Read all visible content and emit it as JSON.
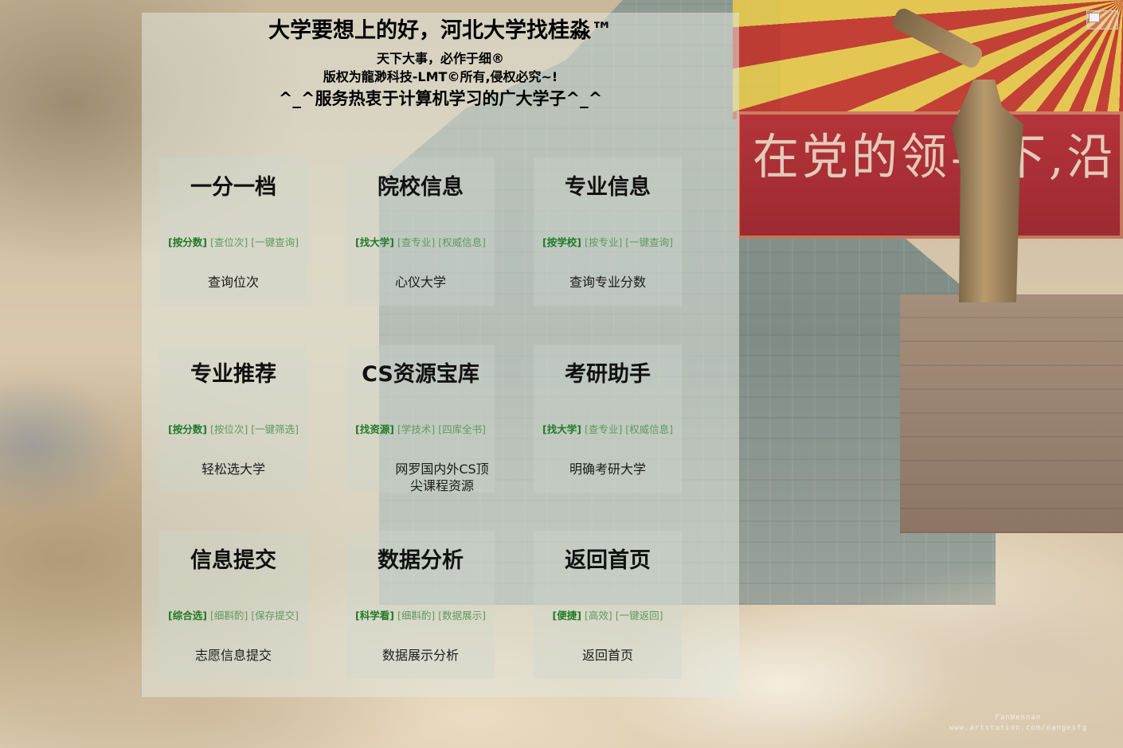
{
  "header": {
    "title": "大学要想上的好，河北大学找桂淼™",
    "line1": "天下大事，必作于细®",
    "line2": "版权为龍渺科技-LMT©所有,侵权必究~!",
    "line3": "^_^服务热衷于计算机学习的广大学子^_^"
  },
  "cards": [
    {
      "title": "一分一档",
      "tags": [
        "[按分数]",
        "[查位次]",
        "[一键查询]"
      ],
      "link": "查询位次"
    },
    {
      "title": "院校信息",
      "tags": [
        "[找大学]",
        "[查专业]",
        "[权威信息]"
      ],
      "link": "心仪大学"
    },
    {
      "title": "专业信息",
      "tags": [
        "[按学校]",
        "[按专业]",
        "[一键查询]"
      ],
      "link": "查询专业分数"
    },
    {
      "title": "专业推荐",
      "tags": [
        "[按分数]",
        "[按位次]",
        "[一键筛选]"
      ],
      "link": "轻松选大学"
    },
    {
      "title": "CS资源宝库",
      "tags": [
        "[找资源]",
        "[学技术]",
        "[四库全书]"
      ],
      "link": "网罗国内外CS顶尖课程资源"
    },
    {
      "title": "考研助手",
      "tags": [
        "[找大学]",
        "[查专业]",
        "[权威信息]"
      ],
      "link": "明确考研大学"
    },
    {
      "title": "信息提交",
      "tags": [
        "[综合选]",
        "[细斟酌]",
        "[保存提交]"
      ],
      "link": "志愿信息提交"
    },
    {
      "title": "数据分析",
      "tags": [
        "[科学看]",
        "[细斟酌]",
        "[数据展示]"
      ],
      "link": "数据展示分析"
    },
    {
      "title": "返回首页",
      "tags": [
        "[便捷]",
        "[高效]",
        "[一键返回]"
      ],
      "link": "返回首页"
    }
  ],
  "background": {
    "banner_text": "在党的领导下,沿",
    "signature_line1": "FanWennan",
    "signature_line2": "www.artstation.com/nangesfg"
  },
  "colors": {
    "tag_active": "#1f7a26",
    "tag_inactive": "#5e9a5e",
    "panel": "rgba(225,232,222,0.55)"
  },
  "icons": {
    "broken_image": "broken-image-icon"
  }
}
